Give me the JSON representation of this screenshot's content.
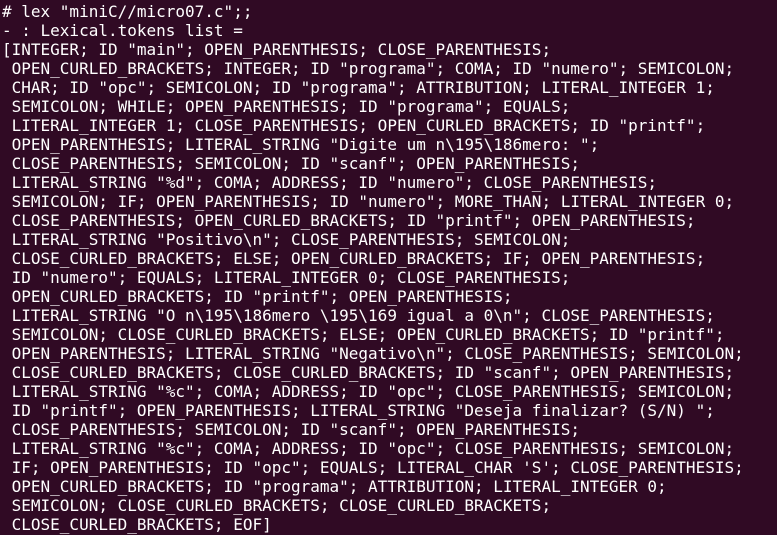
{
  "terminal": {
    "lines": [
      "# lex \"miniC//micro07.c\";;",
      "- : Lexical.tokens list =",
      "[INTEGER; ID \"main\"; OPEN_PARENTHESIS; CLOSE_PARENTHESIS;",
      " OPEN_CURLED_BRACKETS; INTEGER; ID \"programa\"; COMA; ID \"numero\"; SEMICOLON;",
      " CHAR; ID \"opc\"; SEMICOLON; ID \"programa\"; ATTRIBUTION; LITERAL_INTEGER 1;",
      " SEMICOLON; WHILE; OPEN_PARENTHESIS; ID \"programa\"; EQUALS;",
      " LITERAL_INTEGER 1; CLOSE_PARENTHESIS; OPEN_CURLED_BRACKETS; ID \"printf\";",
      " OPEN_PARENTHESIS; LITERAL_STRING \"Digite um n\\195\\186mero: \";",
      " CLOSE_PARENTHESIS; SEMICOLON; ID \"scanf\"; OPEN_PARENTHESIS;",
      " LITERAL_STRING \"%d\"; COMA; ADDRESS; ID \"numero\"; CLOSE_PARENTHESIS;",
      " SEMICOLON; IF; OPEN_PARENTHESIS; ID \"numero\"; MORE_THAN; LITERAL_INTEGER 0;",
      " CLOSE_PARENTHESIS; OPEN_CURLED_BRACKETS; ID \"printf\"; OPEN_PARENTHESIS;",
      " LITERAL_STRING \"Positivo\\n\"; CLOSE_PARENTHESIS; SEMICOLON;",
      " CLOSE_CURLED_BRACKETS; ELSE; OPEN_CURLED_BRACKETS; IF; OPEN_PARENTHESIS;",
      " ID \"numero\"; EQUALS; LITERAL_INTEGER 0; CLOSE_PARENTHESIS;",
      " OPEN_CURLED_BRACKETS; ID \"printf\"; OPEN_PARENTHESIS;",
      " LITERAL_STRING \"O n\\195\\186mero \\195\\169 igual a 0\\n\"; CLOSE_PARENTHESIS;",
      " SEMICOLON; CLOSE_CURLED_BRACKETS; ELSE; OPEN_CURLED_BRACKETS; ID \"printf\";",
      " OPEN_PARENTHESIS; LITERAL_STRING \"Negativo\\n\"; CLOSE_PARENTHESIS; SEMICOLON;",
      " CLOSE_CURLED_BRACKETS; CLOSE_CURLED_BRACKETS; ID \"scanf\"; OPEN_PARENTHESIS;",
      " LITERAL_STRING \"%c\"; COMA; ADDRESS; ID \"opc\"; CLOSE_PARENTHESIS; SEMICOLON;",
      " ID \"printf\"; OPEN_PARENTHESIS; LITERAL_STRING \"Deseja finalizar? (S/N) \";",
      " CLOSE_PARENTHESIS; SEMICOLON; ID \"scanf\"; OPEN_PARENTHESIS;",
      " LITERAL_STRING \"%c\"; COMA; ADDRESS; ID \"opc\"; CLOSE_PARENTHESIS; SEMICOLON;",
      " IF; OPEN_PARENTHESIS; ID \"opc\"; EQUALS; LITERAL_CHAR 'S'; CLOSE_PARENTHESIS;",
      " OPEN_CURLED_BRACKETS; ID \"programa\"; ATTRIBUTION; LITERAL_INTEGER 0;",
      " SEMICOLON; CLOSE_CURLED_BRACKETS; CLOSE_CURLED_BRACKETS;",
      " CLOSE_CURLED_BRACKETS; EOF]"
    ]
  },
  "colors": {
    "background": "#300a24",
    "text": "#ffffff"
  }
}
